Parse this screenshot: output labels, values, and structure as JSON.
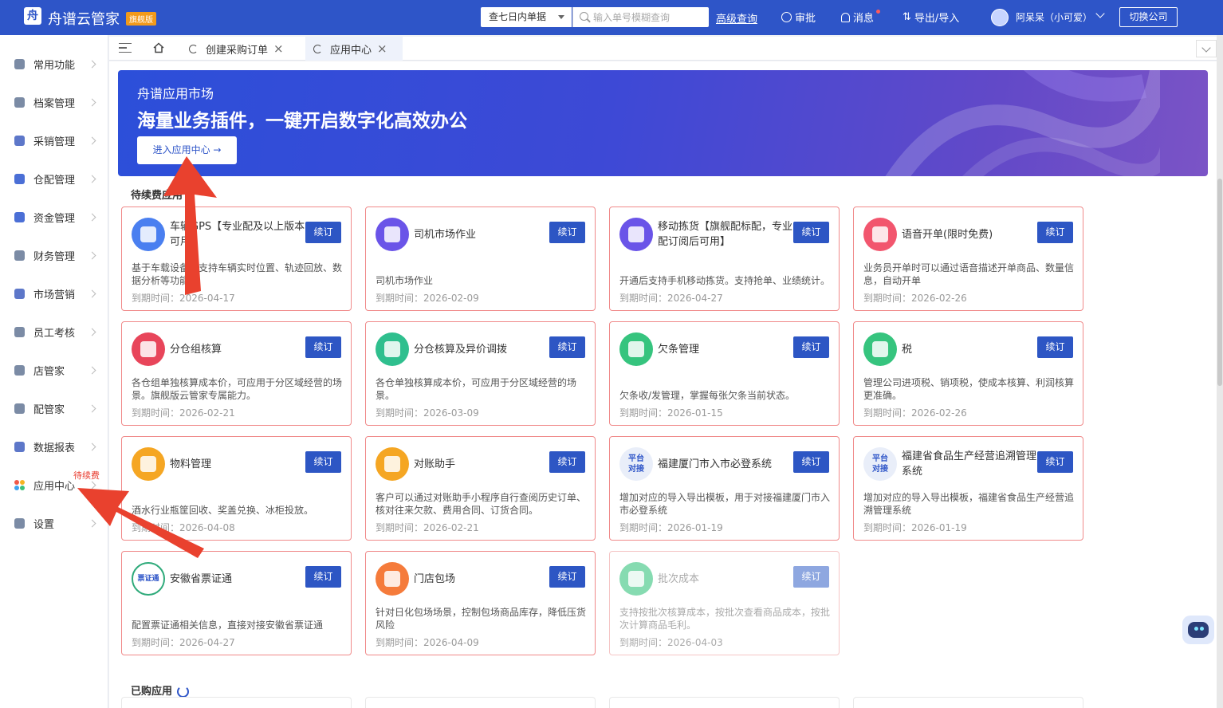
{
  "header": {
    "app_name": "舟谱云管家",
    "edition": "旗舰版",
    "range_select": "查七日内单据",
    "search_placeholder": "输入单号模糊查询",
    "advanced_query": "高级查询",
    "approval": "审批",
    "messages": "消息",
    "export_import": "导出/导入",
    "user": "阿呆呆（小可爱）",
    "switch_company": "切换公司"
  },
  "sidebar": {
    "items": [
      {
        "label": "常用功能"
      },
      {
        "label": "档案管理"
      },
      {
        "label": "采销管理"
      },
      {
        "label": "仓配管理"
      },
      {
        "label": "资金管理"
      },
      {
        "label": "财务管理"
      },
      {
        "label": "市场营销"
      },
      {
        "label": "员工考核"
      },
      {
        "label": "店管家"
      },
      {
        "label": "配管家"
      },
      {
        "label": "数据报表"
      },
      {
        "label": "应用中心",
        "badge": "待续费"
      },
      {
        "label": "设置"
      }
    ]
  },
  "tabs": [
    {
      "label": "创建采购订单"
    },
    {
      "label": "应用中心"
    }
  ],
  "banner": {
    "subtitle": "舟谱应用市场",
    "title": "海量业务插件，一键开启数字化高效办公",
    "button": "进入应用中心 →"
  },
  "sections": {
    "pending_renewal": "待续费应用",
    "purchased": "已购应用"
  },
  "renew_label": "续订",
  "cards": [
    {
      "title": "车辆GPS【专业配及以上版本可用】",
      "desc": "基于车载设备，支持车辆实时位置、轨迹回放、数据分析等功能",
      "expiry": "到期时间：2026-04-17",
      "icon": "vehicle-gps-icon",
      "color": "#4a7ff0"
    },
    {
      "title": "司机市场作业",
      "desc": "司机市场作业",
      "expiry": "到期时间：2026-02-09",
      "icon": "driver-market-icon",
      "color": "#6a54e8"
    },
    {
      "title": "移动拣货【旗舰配标配，专业配订阅后可用】",
      "desc": "开通后支持手机移动拣货。支持抢单、业绩统计。",
      "expiry": "到期时间：2026-04-27",
      "icon": "mobile-picking-icon",
      "color": "#6a54e8"
    },
    {
      "title": "语音开单(限时免费)",
      "desc": "业务员开单时可以通过语音描述开单商品、数量信息，自动开单",
      "expiry": "到期时间：2026-02-26",
      "icon": "voice-order-icon",
      "color": "#f2566e"
    },
    {
      "title": "分仓组核算",
      "desc": "各仓组单独核算成本价，可应用于分区域经营的场景。旗舰版云管家专属能力。",
      "expiry": "到期时间：2026-02-21",
      "icon": "warehouse-group-icon",
      "color": "#e8455a"
    },
    {
      "title": "分仓核算及异价调拨",
      "desc": "各仓单独核算成本价，可应用于分区域经营的场景。",
      "expiry": "到期时间：2026-03-09",
      "icon": "warehouse-transfer-icon",
      "color": "#2fbf8e"
    },
    {
      "title": "欠条管理",
      "desc": "欠条收/发管理，掌握每张欠条当前状态。",
      "expiry": "到期时间：2026-01-15",
      "icon": "iou-icon",
      "color": "#36c47e"
    },
    {
      "title": "税",
      "desc": "管理公司进项税、销项税，使成本核算、利润核算更准确。",
      "expiry": "到期时间：2026-02-26",
      "icon": "tax-icon",
      "color": "#36c47e"
    },
    {
      "title": "物料管理",
      "desc": "酒水行业瓶筐回收、奖盖兑换、冰柜投放。",
      "expiry": "到期时间：2026-04-08",
      "icon": "material-icon",
      "color": "#f5a623"
    },
    {
      "title": "对账助手",
      "desc": "客户可以通过对账助手小程序自行查阅历史订单、核对往来欠款、费用合同、订货合同。",
      "expiry": "到期时间：2026-02-21",
      "icon": "reconcile-icon",
      "color": "#f5a623"
    },
    {
      "title": "福建厦门市入市必登系统",
      "desc": "增加对应的导入导出模板，用于对接福建厦门市入市必登系统",
      "expiry": "到期时间：2026-01-19",
      "icon": "platform-link-icon",
      "color": "#e9eef9",
      "icon_text": "平台对接"
    },
    {
      "title": "福建省食品生产经营追溯管理系统",
      "desc": "增加对应的导入导出模板，福建省食品生产经营追溯管理系统",
      "expiry": "到期时间：2026-01-19",
      "icon": "platform-link-icon",
      "color": "#e9eef9",
      "icon_text": "平台对接"
    },
    {
      "title": "安徽省票证通",
      "desc": "配置票证通相关信息，直接对接安徽省票证通",
      "expiry": "到期时间：2026-04-27",
      "icon": "ticket-link-icon",
      "color": "#ffffff",
      "icon_text": "票证通"
    },
    {
      "title": "门店包场",
      "desc": "针对日化包场场景，控制包场商品库存，降低压货风险",
      "expiry": "到期时间：2026-04-09",
      "icon": "store-package-icon",
      "color": "#f57b3b"
    },
    {
      "title": "批次成本",
      "desc": "支持按批次核算成本，按批次查看商品成本，按批次计算商品毛利。",
      "expiry": "到期时间：2026-04-03",
      "icon": "batch-cost-icon",
      "color": "#36c47e"
    }
  ]
}
